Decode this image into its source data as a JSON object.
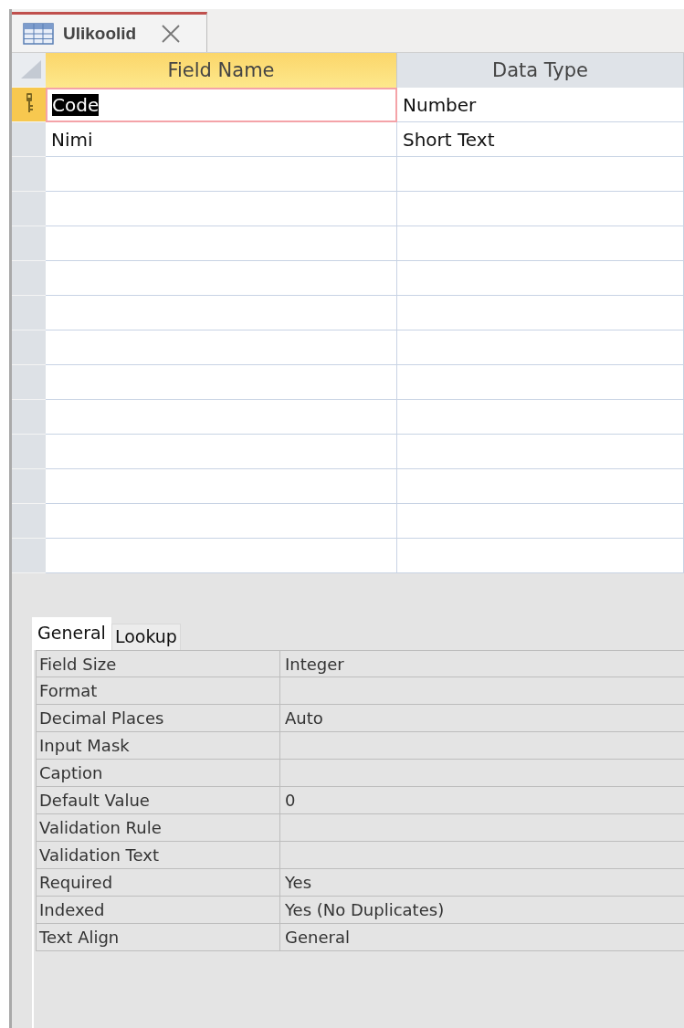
{
  "document_tab": {
    "title": "Ulikoolid",
    "selected": true
  },
  "design_grid": {
    "columns": [
      {
        "label": "Field Name",
        "selected": true
      },
      {
        "label": "Data Type",
        "selected": false
      }
    ],
    "rows": [
      {
        "field_name": "Code",
        "data_type": "Number",
        "primary_key": true,
        "selected": true
      },
      {
        "field_name": "Nimi",
        "data_type": "Short Text",
        "primary_key": false,
        "selected": false
      }
    ]
  },
  "property_tabs": [
    {
      "label": "General",
      "selected": true
    },
    {
      "label": "Lookup",
      "selected": false
    }
  ],
  "properties": [
    {
      "label": "Field Size",
      "value": "Integer"
    },
    {
      "label": "Format"
    },
    {
      "label": "Decimal Places",
      "value": "Auto"
    },
    {
      "label": "Input Mask"
    },
    {
      "label": "Caption"
    },
    {
      "label": "Default Value",
      "value": "0"
    },
    {
      "label": "Validation Rule"
    },
    {
      "label": "Validation Text"
    },
    {
      "label": "Required",
      "value": "Yes"
    },
    {
      "label": "Indexed",
      "value": "Yes (No Duplicates)"
    },
    {
      "label": "Text Align",
      "value": "General"
    }
  ]
}
